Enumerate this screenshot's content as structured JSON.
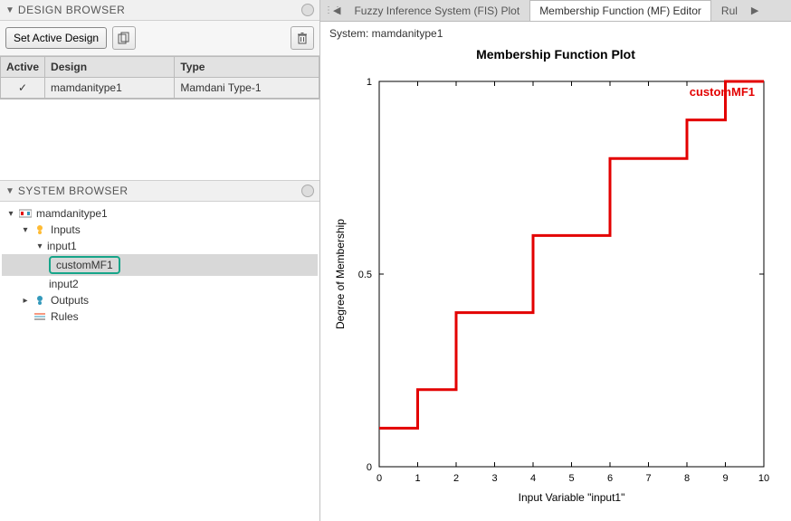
{
  "design_browser": {
    "title": "DESIGN BROWSER",
    "set_active_label": "Set Active Design",
    "columns": {
      "active": "Active",
      "design": "Design",
      "type": "Type"
    },
    "row": {
      "active": "✓",
      "design": "mamdanitype1",
      "type": "Mamdani Type-1"
    }
  },
  "system_browser": {
    "title": "SYSTEM BROWSER",
    "root": "mamdanitype1",
    "inputs_label": "Inputs",
    "input1": "input1",
    "custommf1": "customMF1",
    "input2": "input2",
    "outputs_label": "Outputs",
    "rules_label": "Rules"
  },
  "tabs": {
    "fis": "Fuzzy Inference System (FIS) Plot",
    "mf": "Membership Function (MF) Editor",
    "rules": "Rul"
  },
  "system_label": "System: mamdanitype1",
  "chart_data": {
    "type": "line",
    "title": "Membership Function Plot",
    "xlabel": "Input Variable \"input1\"",
    "ylabel": "Degree of Membership",
    "mf_label": "customMF1",
    "xlim": [
      0,
      10
    ],
    "ylim": [
      0,
      1
    ],
    "xticks": [
      0,
      1,
      2,
      3,
      4,
      5,
      6,
      7,
      8,
      9,
      10
    ],
    "yticks": [
      0,
      0.5,
      1
    ],
    "step_points": [
      {
        "x": 0,
        "y": 0.1
      },
      {
        "x": 1,
        "y": 0.1
      },
      {
        "x": 1,
        "y": 0.2
      },
      {
        "x": 2,
        "y": 0.2
      },
      {
        "x": 2,
        "y": 0.4
      },
      {
        "x": 4,
        "y": 0.4
      },
      {
        "x": 4,
        "y": 0.6
      },
      {
        "x": 6,
        "y": 0.6
      },
      {
        "x": 6,
        "y": 0.8
      },
      {
        "x": 8,
        "y": 0.8
      },
      {
        "x": 8,
        "y": 0.9
      },
      {
        "x": 9,
        "y": 0.9
      },
      {
        "x": 9,
        "y": 1.0
      },
      {
        "x": 10,
        "y": 1.0
      }
    ]
  }
}
